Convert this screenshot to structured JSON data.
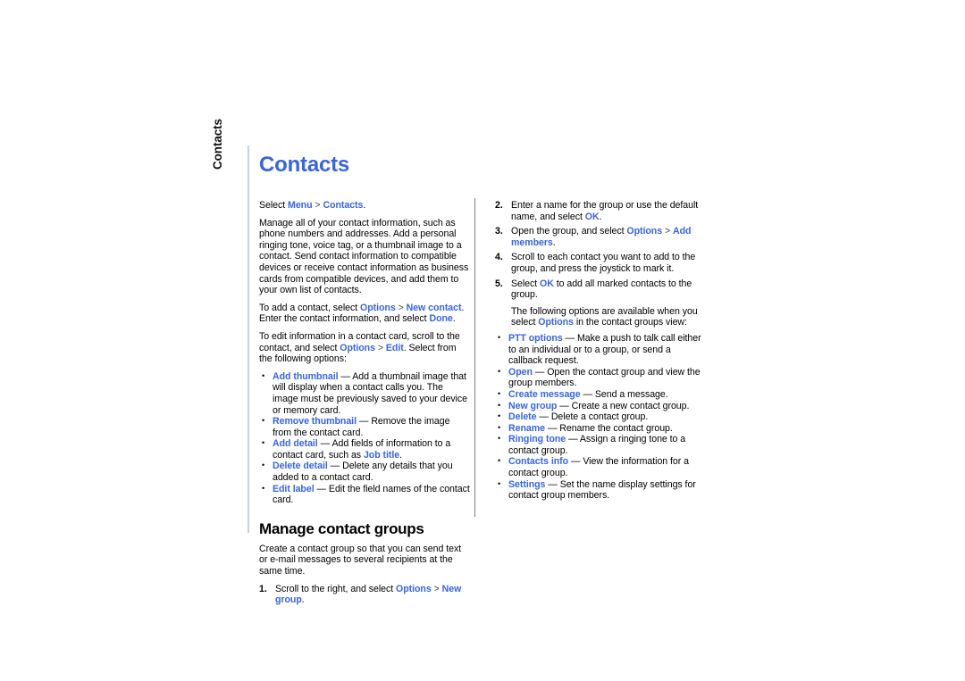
{
  "page": {
    "side_tab": "Contacts",
    "title": "Contacts"
  },
  "left_column": {
    "intro_line": {
      "prefix": "Select ",
      "link1": "Menu",
      "sep": " > ",
      "link2": "Contacts",
      "suffix": "."
    },
    "paragraph1": "Manage all of your contact information, such as phone numbers and addresses. Add a personal ringing tone, voice tag, or a thumbnail image to a contact. Send contact information to compatible devices or receive contact information as business cards from compatible devices, and add them to your own list of contacts.",
    "paragraph2": {
      "t1": "To add a contact, select ",
      "link1": "Options",
      "sep": " > ",
      "link2": "New contact",
      "t2": ". Enter the contact information, and select ",
      "link3": "Done",
      "t3": "."
    },
    "paragraph3": {
      "t1": "To edit information in a contact card, scroll to the contact, and select ",
      "link1": "Options",
      "sep": " > ",
      "link2": "Edit",
      "t2": ". Select from the following options:"
    },
    "options": [
      {
        "term": "Add thumbnail",
        "desc": " — Add a thumbnail image that will display when a contact calls you. The image must be previously saved to your device or memory card."
      },
      {
        "term": "Remove thumbnail",
        "desc": " — Remove the image from the contact card."
      },
      {
        "term": "Add detail",
        "desc_pre": " — Add fields of information to a contact card, such as ",
        "desc_link": "Job title",
        "desc_post": "."
      },
      {
        "term": "Delete detail",
        "desc": " — Delete any details that you added to a contact card."
      },
      {
        "term": "Edit label",
        "desc": " — Edit the field names of the contact card."
      }
    ],
    "section_title": "Manage contact groups",
    "section_intro": "Create a contact group so that you can send text or e-mail messages to several recipients at the same time.",
    "step1": {
      "marker": "1.",
      "t1": "Scroll to the right, and select ",
      "link1": "Options",
      "sep": " > ",
      "link2": "New group",
      "t2": "."
    }
  },
  "right_column": {
    "steps": [
      {
        "marker": "2.",
        "t1": "Enter a name for the group or use the default name, and select ",
        "link1": "OK",
        "t2": "."
      },
      {
        "marker": "3.",
        "t1": "Open the group, and select ",
        "link1": "Options",
        "sep": " > ",
        "link2": "Add members",
        "t2": "."
      },
      {
        "marker": "4.",
        "t1": "Scroll to each contact you want to add to the group, and press the joystick to mark it."
      },
      {
        "marker": "5.",
        "t1": "Select ",
        "link1": "OK",
        "t2": " to add all marked contacts to the group."
      }
    ],
    "following_para": {
      "t1": "The following options are available when you select ",
      "link1": "Options",
      "t2": " in the contact groups view:"
    },
    "options": [
      {
        "term": "PTT options",
        "desc": " — Make a push to talk call either to an individual or to a group, or send a callback request."
      },
      {
        "term": "Open",
        "desc": " — Open the contact group and view the group members."
      },
      {
        "term": "Create message",
        "desc": " — Send a message."
      },
      {
        "term": "New group",
        "desc": " — Create a new contact group."
      },
      {
        "term": "Delete",
        "desc": " — Delete a contact group."
      },
      {
        "term": "Rename",
        "desc": " — Rename the contact group."
      },
      {
        "term": "Ringing tone",
        "desc": " — Assign a ringing tone to a contact group."
      },
      {
        "term": "Contacts info",
        "desc": " — View the information for a contact group."
      },
      {
        "term": "Settings",
        "desc": " — Set the name display settings for contact group members."
      }
    ]
  },
  "colors": {
    "link_blue": "#3764e4",
    "title_blue": "#3764e4",
    "rule_gray": "#7d7d7d",
    "left_rule": "#c9d2e0"
  }
}
